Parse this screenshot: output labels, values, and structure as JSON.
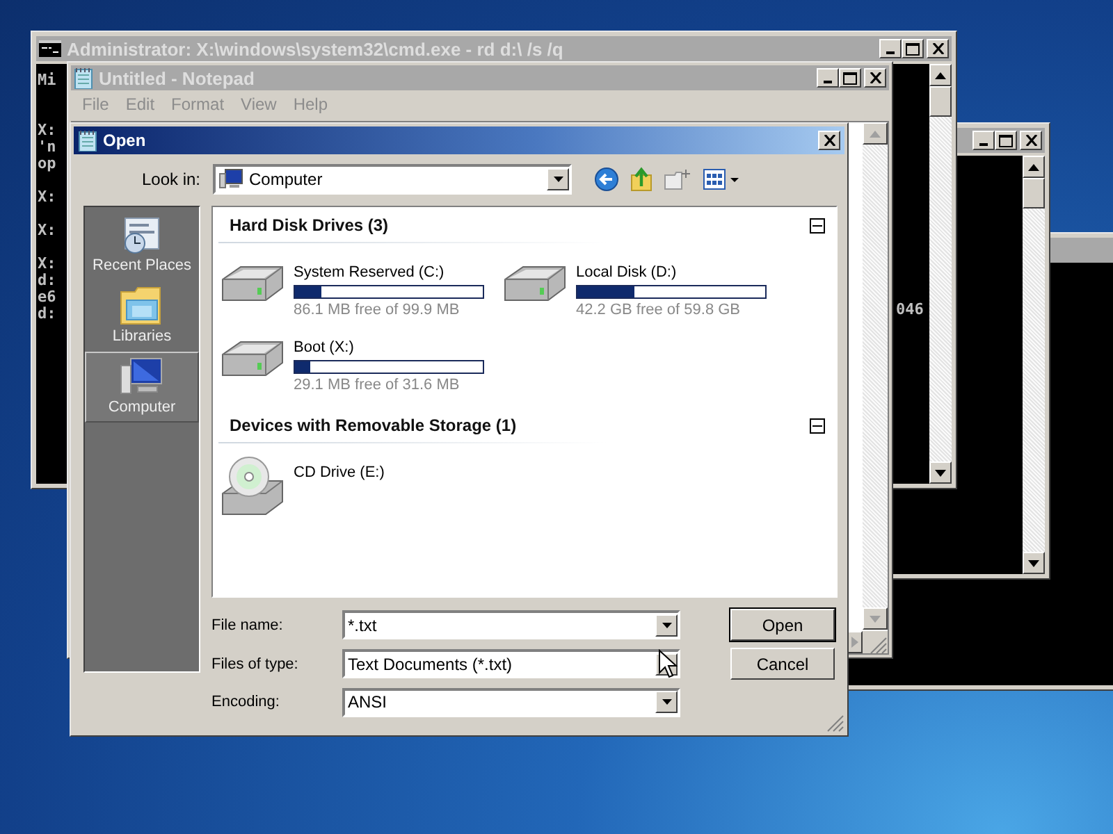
{
  "console": {
    "title": "Administrator: X:\\windows\\system32\\cmd.exe - rd  d:\\ /s /q",
    "blocks": [
      [
        "Mi"
      ],
      [
        "X:",
        "'n",
        "op"
      ],
      [
        "X:"
      ],
      [
        "X:"
      ],
      [
        "X:",
        "d:",
        "e6",
        "d:"
      ]
    ],
    "right_fragment": "046"
  },
  "notepad": {
    "title": "Untitled - Notepad",
    "menu": [
      "File",
      "Edit",
      "Format",
      "View",
      "Help"
    ]
  },
  "dialog": {
    "title": "Open",
    "look_in": {
      "label": "Look in:",
      "value": "Computer"
    },
    "places": [
      {
        "label": "Recent Places",
        "kind": "recent",
        "selected": false
      },
      {
        "label": "Libraries",
        "kind": "libraries",
        "selected": false
      },
      {
        "label": "Computer",
        "kind": "computer",
        "selected": true
      }
    ],
    "groups": [
      {
        "title": "Hard Disk Drives (3)",
        "expanded": true,
        "items": [
          {
            "name": "System Reserved (C:)",
            "kind": "disk",
            "level": 0.14,
            "free": "86.1 MB free of 99.9 MB"
          },
          {
            "name": "Local Disk (D:)",
            "kind": "disk",
            "level": 0.3,
            "free": "42.2 GB free of 59.8 GB"
          },
          {
            "name": "Boot (X:)",
            "kind": "disk",
            "level": 0.08,
            "free": "29.1 MB free of 31.6 MB"
          }
        ]
      },
      {
        "title": "Devices with Removable Storage (1)",
        "expanded": true,
        "items": [
          {
            "name": "CD Drive (E:)",
            "kind": "optical"
          }
        ]
      }
    ],
    "fields": [
      {
        "label": "File name:",
        "value": "*.txt"
      },
      {
        "label": "Files of type:",
        "value": "Text Documents (*.txt)"
      },
      {
        "label": "Encoding:",
        "value": "ANSI"
      }
    ],
    "buttons": [
      {
        "label": "Open",
        "default": true
      },
      {
        "label": "Cancel",
        "default": false
      }
    ]
  }
}
